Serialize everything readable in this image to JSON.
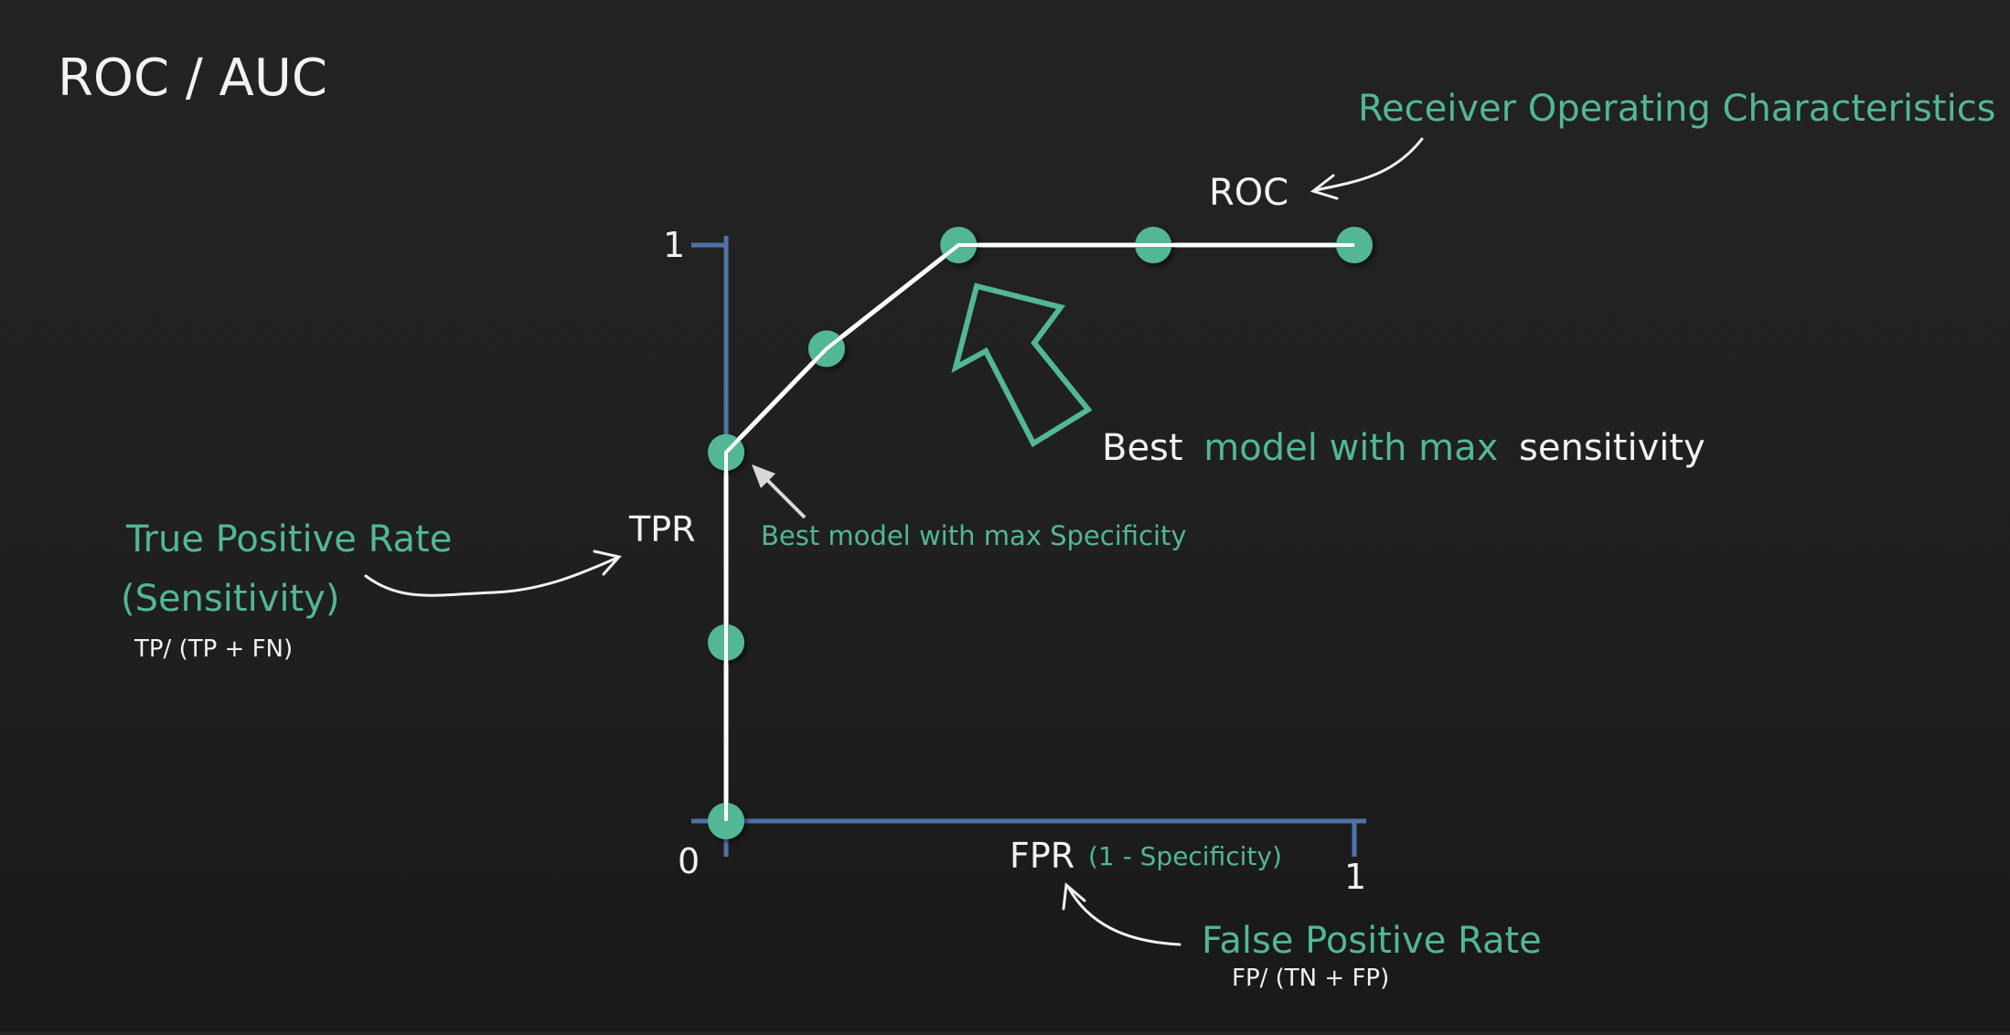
{
  "slide": {
    "title": "ROC / AUC"
  },
  "colors": {
    "background": "#222222",
    "axis": "#4f72a8",
    "curve": "#ffffff",
    "point": "#52b795",
    "accent_text": "#52b795",
    "text": "#f2f2f2"
  },
  "chart_data": {
    "type": "line",
    "title": "ROC",
    "xlabel": "FPR",
    "xlabel_note": "(1 - Specificity)",
    "ylabel": "TPR",
    "xlim": [
      0,
      1
    ],
    "ylim": [
      0,
      1
    ],
    "x_tick_labels": [
      "0",
      "1"
    ],
    "y_tick_labels": [
      "1"
    ],
    "grid": false,
    "series": [
      {
        "name": "ROC",
        "x": [
          0,
          0,
          0,
          0.16,
          0.37,
          0.68,
          1.0
        ],
        "y": [
          0,
          0.31,
          0.64,
          0.82,
          1.0,
          1.0,
          1.0
        ]
      }
    ],
    "annotations": {
      "roc_full": "Receiver Operating Characteristics",
      "tpr_line1": "True Positive Rate",
      "tpr_line2": "(Sensitivity)",
      "tpr_formula": "TP/ (TP + FN)",
      "fpr_full": "False Positive Rate",
      "fpr_formula": "FP/ (TN + FP)",
      "best_specificity": "Best model with max Specificity",
      "best_sensitivity_1": "Best",
      "best_sensitivity_2": "model with max",
      "best_sensitivity_3": "sensitivity"
    }
  }
}
